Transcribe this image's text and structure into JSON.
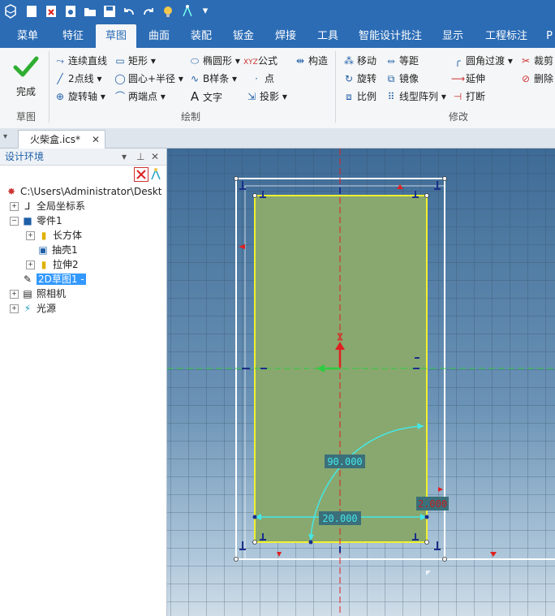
{
  "quick_access": {
    "icons": [
      "app-logo-icon",
      "new-file-icon",
      "close-file-icon",
      "save-as-icon",
      "open-file-icon",
      "save-icon",
      "undo-icon",
      "redo-icon",
      "lightbulb-icon",
      "smart-icon",
      "dropdown-icon"
    ]
  },
  "tabs": [
    "菜单",
    "特征",
    "草图",
    "曲面",
    "装配",
    "钣金",
    "焊接",
    "工具",
    "智能设计批注",
    "显示",
    "工程标注",
    "P"
  ],
  "active_tab": "草图",
  "ribbon": {
    "finish_label": "完成",
    "groups": {
      "sketch": "草图",
      "draw": "绘制",
      "modify": "修改"
    },
    "draw": {
      "polyline": "连续直线",
      "rectangle": "矩形",
      "ellipse": "椭圆形",
      "formula": "公式",
      "construct": "构造",
      "two_point": "2点线",
      "center_radius": "圆心+半径",
      "bspline": "B样条",
      "point": "点",
      "rotate_axis": "旋转轴",
      "two_endpoint": "两端点",
      "text": "文字",
      "project": "投影"
    },
    "modify": {
      "move": "移动",
      "offset": "等距",
      "fillet": "圆角过渡",
      "trim": "裁剪",
      "rotate": "旋转",
      "mirror": "镜像",
      "extend": "延伸",
      "delete": "删除",
      "scale": "比例",
      "linear_array": "线型阵列",
      "break": "打断"
    }
  },
  "document_tab": "火柴盒.ics*",
  "left_panel": {
    "title": "设计环境",
    "tree": [
      {
        "label": "C:\\Users\\Administrator\\Deskt",
        "level": 0
      },
      {
        "label": "全局坐标系",
        "level": 1
      },
      {
        "label": "零件1",
        "level": 1
      },
      {
        "label": "长方体",
        "level": 2
      },
      {
        "label": "抽壳1",
        "level": 2
      },
      {
        "label": "拉伸2",
        "level": 2
      },
      {
        "label": "2D草图1 -",
        "level": 1,
        "selected": true
      },
      {
        "label": "照相机",
        "level": 1
      },
      {
        "label": "光源",
        "level": 1
      }
    ]
  },
  "sketch": {
    "angle_dim": "90.000",
    "width_dim": "20.000",
    "offset_dim": "2.000"
  },
  "colors": {
    "ribbon_blue": "#2b6cb5",
    "sketch_fill": "#88a86f",
    "sketch_outline": "#f0f030",
    "dimension": "#44e8e8",
    "axis_red": "#e02020",
    "axis_green": "#2ecc40"
  }
}
